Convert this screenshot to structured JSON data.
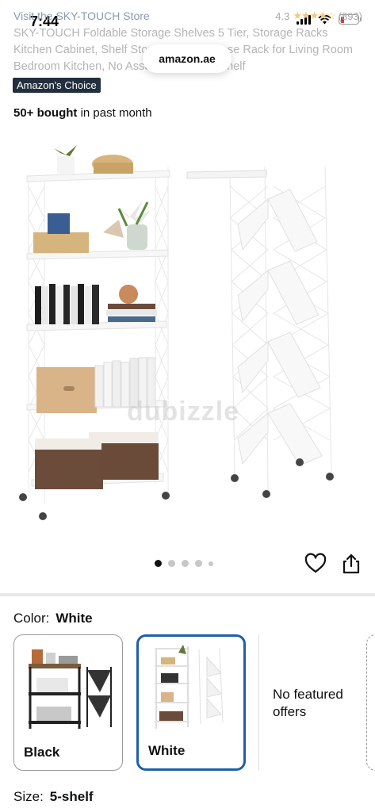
{
  "status": {
    "time": "7:44",
    "url": "amazon.ae"
  },
  "header": {
    "store_link": "Visit the SKY-TOUCH Store",
    "rating": "4.3",
    "review_count": "(893)",
    "title": "SKY-TOUCH Foldable Storage Shelves 5 Tier, Storage Racks Kitchen Cabinet, Shelf Storage Multipurpose Rack for Living Room Bedroom Kitchen, No Assembly White 5-shelf",
    "badge": "Amazon's Choice",
    "bought_bold": "50+ bought",
    "bought_rest": " in past month"
  },
  "image": {
    "watermark": "dubizzle",
    "dot_count": 5,
    "active_dot": 0
  },
  "icons": {
    "heart": "heart-icon",
    "share": "share-icon"
  },
  "variation": {
    "color_label": "Color:",
    "color_value": "White",
    "swatches": [
      {
        "label": "Black",
        "selected": false
      },
      {
        "label": "White",
        "selected": true
      }
    ],
    "no_offers": "No featured offers",
    "size_label": "Size:",
    "size_value": "5-shelf"
  },
  "colors": {
    "accent_border": "#1f5faa",
    "badge_bg": "#232f3e",
    "star": "#f6c57a"
  }
}
